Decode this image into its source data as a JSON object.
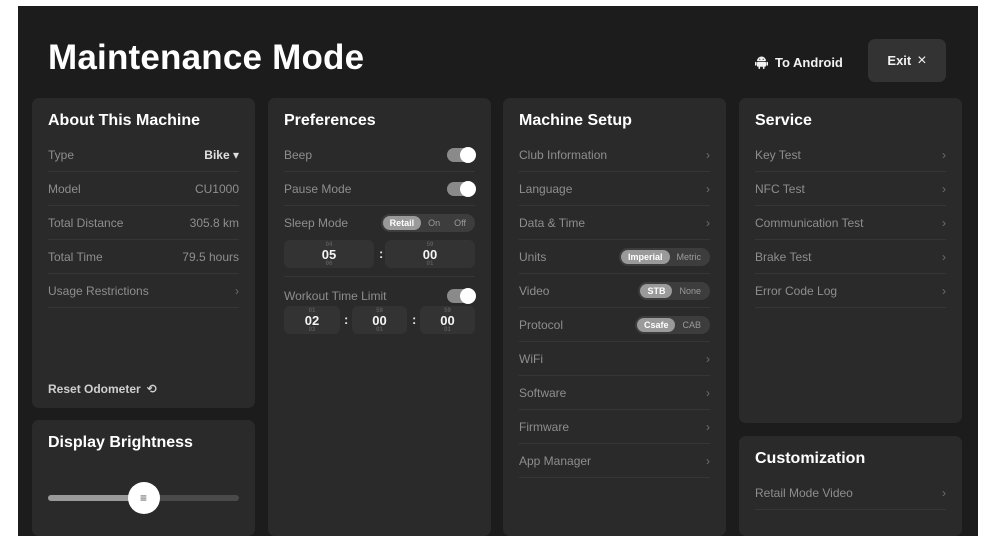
{
  "header": {
    "title": "Maintenance Mode",
    "to_android_label": "To Android",
    "exit_label": "Exit",
    "exit_icon": "×"
  },
  "about": {
    "title": "About This Machine",
    "rows": [
      {
        "label": "Type",
        "value": "Bike ▾"
      },
      {
        "label": "Model",
        "value": "CU1000"
      },
      {
        "label": "Total Distance",
        "value": "305.8 km"
      },
      {
        "label": "Total Time",
        "value": "79.5 hours"
      },
      {
        "label": "Usage Restrictions",
        "value": "›"
      }
    ],
    "reset_label": "Reset Odometer",
    "reset_icon": "⟲"
  },
  "brightness": {
    "title": "Display Brightness",
    "level": 0.5,
    "knob_icon": "≡"
  },
  "preferences": {
    "title": "Preferences",
    "beep_label": "Beep",
    "beep_on": true,
    "pause_label": "Pause Mode",
    "pause_on": true,
    "sleep_label": "Sleep Mode",
    "sleep_options": [
      "Retail",
      "On",
      "Off"
    ],
    "sleep_selected": "Retail",
    "sleep_hours": "05",
    "sleep_minutes": "00",
    "workout_label": "Workout Time Limit",
    "workout_on": true,
    "workout_hours": "02",
    "workout_minutes": "00",
    "workout_seconds": "00",
    "colon": ":"
  },
  "setup": {
    "title": "Machine Setup",
    "club_information": "Club Information",
    "language": "Language",
    "date_time": "Data & Time",
    "units_label": "Units",
    "units_options": [
      "Imperial",
      "Metric"
    ],
    "units_selected": "Imperial",
    "video_label": "Video",
    "video_options": [
      "STB",
      "None"
    ],
    "video_selected": "STB",
    "protocol_label": "Protocol",
    "protocol_options": [
      "Csafe",
      "CAB"
    ],
    "protocol_selected": "Csafe",
    "wifi": "WiFi",
    "software": "Software",
    "firmware": "Firmware",
    "app_manager": "App Manager",
    "chevron": "›"
  },
  "service": {
    "title": "Service",
    "key_test": "Key Test",
    "nfc_test": "NFC Test",
    "communication_test": "Communication Test",
    "brake_test": "Brake Test",
    "error_code_log": "Error Code Log"
  },
  "customization": {
    "title": "Customization",
    "retail_mode_video": "Retail Mode Video"
  },
  "colors": {
    "background": "#1c1c1c",
    "card": "#2a2a2a",
    "toggle_on": "#8a8a8a",
    "segment_selected": "#9a9a9a"
  }
}
